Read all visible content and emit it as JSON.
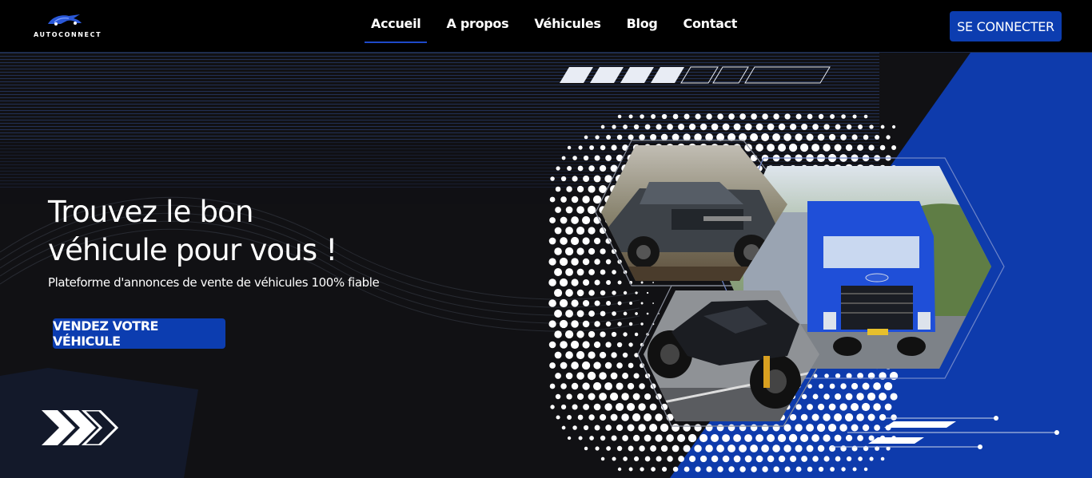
{
  "brand": {
    "name": "AUTOCONNECT",
    "logo_icon": "car-logo-icon"
  },
  "nav": {
    "items": [
      {
        "label": "Accueil",
        "active": true
      },
      {
        "label": "A propos",
        "active": false
      },
      {
        "label": "Véhicules",
        "active": false
      },
      {
        "label": "Blog",
        "active": false
      },
      {
        "label": "Contact",
        "active": false
      }
    ],
    "login_label": "SE CONNECTER"
  },
  "hero": {
    "title_line1": "Trouvez le bon",
    "title_line2": "véhicule pour vous !",
    "subtitle": "Plateforme d'annonces de vente de véhicules 100% fiable",
    "cta_label": "VENDEZ VOTRE VÉHICULE",
    "images": [
      {
        "name": "pickup-truck-image",
        "depicts": "grey pickup truck"
      },
      {
        "name": "blue-truck-image",
        "depicts": "blue semi truck"
      },
      {
        "name": "motorcycle-image",
        "depicts": "black sport motorcycle"
      }
    ],
    "decor_icon": "triple-arrow-icon"
  },
  "colors": {
    "accent": "#0c3db0",
    "panel_blue": "#0e3bac",
    "background": "#111114",
    "nav_bg": "#000000"
  }
}
